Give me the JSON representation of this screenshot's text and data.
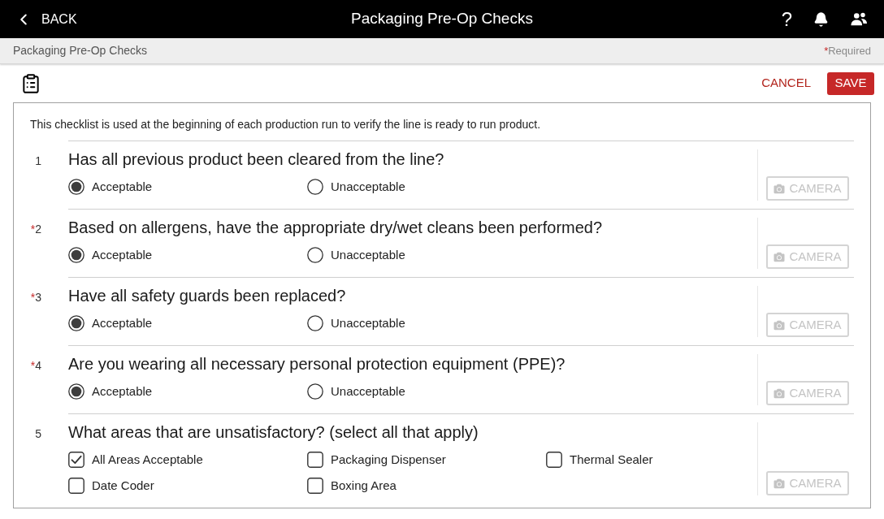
{
  "header": {
    "back_button": {
      "label": "BACK"
    },
    "title": "Packaging Pre-Op Checks",
    "help_button": {
      "label": "?"
    }
  },
  "subheader": {
    "breadcrumb": "Packaging Pre-Op Checks",
    "required_note": {
      "marker": "*",
      "label": "Required"
    }
  },
  "toolbar": {
    "cancel_button": {
      "label": "CANCEL"
    },
    "save_button": {
      "label": "SAVE"
    }
  },
  "checklist": {
    "description": "This checklist is used at the beginning of each production run to verify the line is ready to run product.",
    "questions": [
      {
        "kind": "radio",
        "number": "1",
        "question": "Has all previous product been cleared from the line?",
        "options": [
          {
            "label": "Acceptable",
            "selected": true
          },
          {
            "label": "Unacceptable",
            "selected": false
          }
        ],
        "camera_button": {
          "label": "CAMERA",
          "disabled": true
        }
      },
      {
        "kind": "radio",
        "marker": "*",
        "number": "2",
        "question": "Based on allergens, have the appropriate dry/wet cleans been performed?",
        "options": [
          {
            "label": "Acceptable",
            "selected": true
          },
          {
            "label": "Unacceptable",
            "selected": false
          }
        ],
        "camera_button": {
          "label": "CAMERA",
          "disabled": true
        }
      },
      {
        "kind": "radio",
        "marker": "*",
        "number": "3",
        "question": "Have all safety guards been replaced?",
        "options": [
          {
            "label": "Acceptable",
            "selected": true
          },
          {
            "label": "Unacceptable",
            "selected": false
          }
        ],
        "camera_button": {
          "label": "CAMERA",
          "disabled": true
        }
      },
      {
        "kind": "radio",
        "marker": "*",
        "number": "4",
        "question": "Are you wearing all necessary personal protection equipment (PPE)?",
        "options": [
          {
            "label": "Acceptable",
            "selected": true
          },
          {
            "label": "Unacceptable",
            "selected": false
          }
        ],
        "camera_button": {
          "label": "CAMERA",
          "disabled": true
        }
      },
      {
        "kind": "checkbox",
        "number": "5",
        "question": "What areas that are unsatisfactory? (select all that apply)",
        "options": [
          {
            "label": "All Areas Acceptable",
            "checked": true
          },
          {
            "label": "Packaging Dispenser",
            "checked": false
          },
          {
            "label": "Thermal Sealer",
            "checked": false
          },
          {
            "label": "Date Coder",
            "checked": false
          },
          {
            "label": "Boxing Area",
            "checked": false
          }
        ],
        "camera_button": {
          "label": "CAMERA",
          "disabled": true
        }
      }
    ]
  }
}
